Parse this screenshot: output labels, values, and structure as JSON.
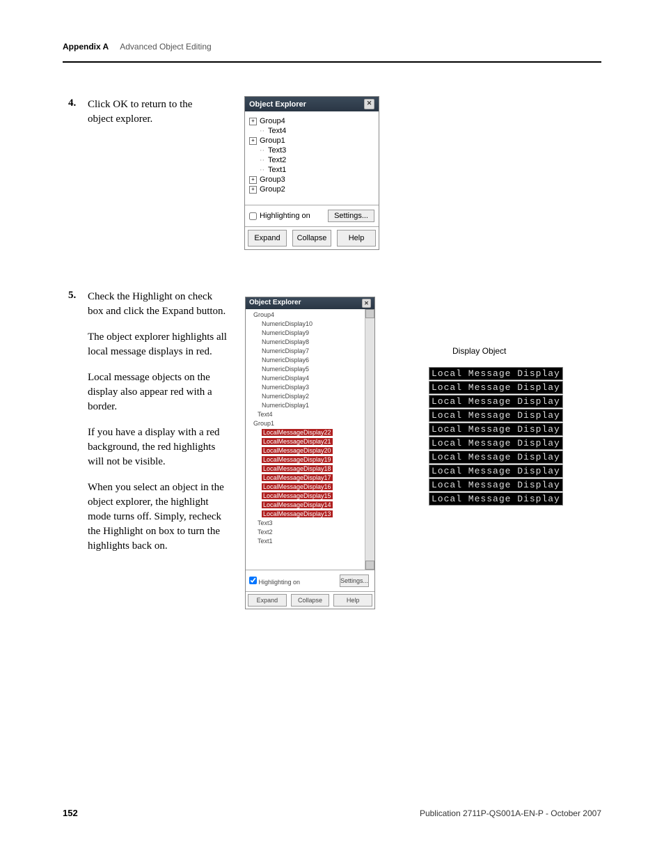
{
  "header": {
    "appendix": "Appendix A",
    "section": "Advanced Object Editing"
  },
  "step4": {
    "num": "4.",
    "text": "Click OK to return to the object explorer."
  },
  "step5": {
    "num": "5.",
    "p1": "Check the Highlight on check box and click the Expand button.",
    "p2": "The object explorer highlights all local message displays in red.",
    "p3": "Local message objects on the display also appear red with a border.",
    "p4": "If you have a display with a red background, the red highlights will not be visible.",
    "p5": "When you select an object in the object explorer, the highlight mode turns off. Simply, recheck the Highlight on box to turn the highlights back on."
  },
  "oe1": {
    "title": "Object Explorer",
    "items": {
      "g4": "Group4",
      "t4": "Text4",
      "g1": "Group1",
      "t3": "Text3",
      "t2": "Text2",
      "t1": "Text1",
      "g3": "Group3",
      "g2": "Group2"
    },
    "highlight_label": "Highlighting on",
    "settings": "Settings...",
    "expand": "Expand",
    "collapse": "Collapse",
    "help": "Help"
  },
  "oe2": {
    "title": "Object Explorer",
    "g4": "Group4",
    "nd": [
      "NumericDisplay10",
      "NumericDisplay9",
      "NumericDisplay8",
      "NumericDisplay7",
      "NumericDisplay6",
      "NumericDisplay5",
      "NumericDisplay4",
      "NumericDisplay3",
      "NumericDisplay2",
      "NumericDisplay1"
    ],
    "t4": "Text4",
    "g1": "Group1",
    "lmd": [
      "LocalMessageDisplay22",
      "LocalMessageDisplay21",
      "LocalMessageDisplay20",
      "LocalMessageDisplay19",
      "LocalMessageDisplay18",
      "LocalMessageDisplay17",
      "LocalMessageDisplay16",
      "LocalMessageDisplay15",
      "LocalMessageDisplay14",
      "LocalMessageDisplay13"
    ],
    "t3": "Text3",
    "t2": "Text2",
    "t1": "Text1",
    "highlight_label": "Highlighting on",
    "settings": "Settings...",
    "expand": "Expand",
    "collapse": "Collapse",
    "help": "Help"
  },
  "display": {
    "label": "Display Object",
    "row": "Local Message Display",
    "count": 10
  },
  "footer": {
    "page": "152",
    "pub": "Publication 2711P-QS001A-EN-P - October 2007"
  }
}
